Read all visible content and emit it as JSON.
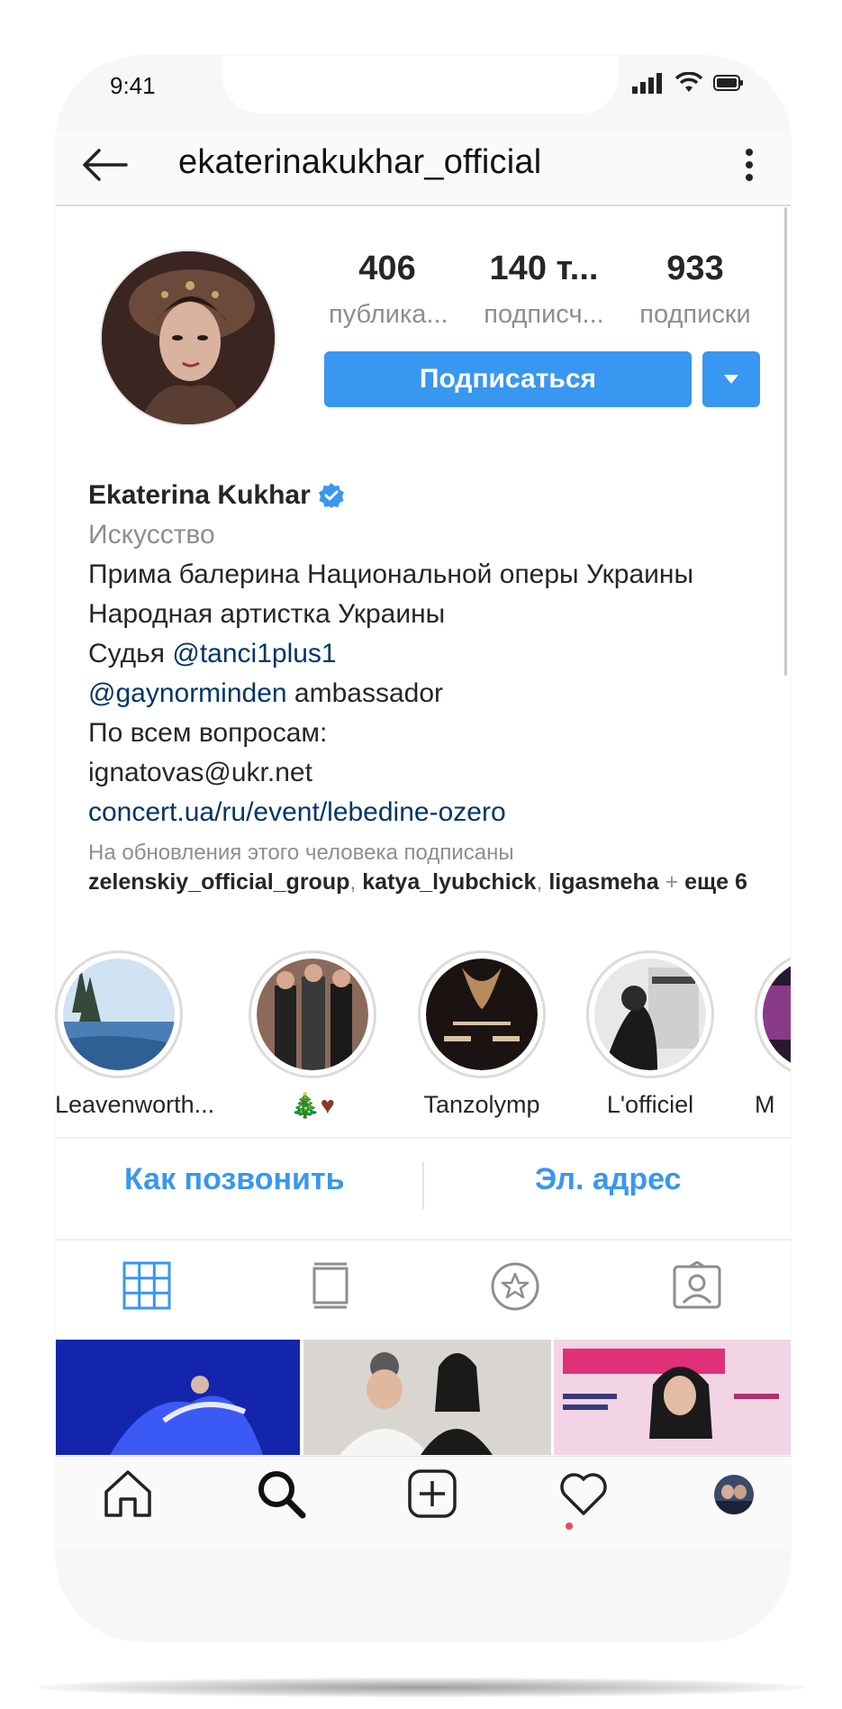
{
  "status_bar": {
    "time": "9:41"
  },
  "header": {
    "username": "ekaterinakukhar_official"
  },
  "stats": [
    {
      "value": "406",
      "label": "публика..."
    },
    {
      "value": "140 т...",
      "label": "подписч..."
    },
    {
      "value": "933",
      "label": "подписки"
    }
  ],
  "actions": {
    "follow_label": "Подписаться"
  },
  "bio": {
    "name": "Ekaterina Kukhar",
    "category": "Искусство",
    "line1": "Прима балерина Национальной оперы Украины",
    "line2": "Народная артистка Украины",
    "line3_prefix": "Судья ",
    "line3_link": "@tanci1plus1",
    "line4_link": "@gaynorminden",
    "line4_suffix": " ambassador",
    "line5": "По всем вопросам:",
    "line6": "ignatovas@ukr.net",
    "website": "concert.ua/ru/event/lebedine-ozero"
  },
  "followed_by": {
    "note": "На обновления этого человека подписаны",
    "user1": "zelenskiy_official_group",
    "user2": "katya_lyubchick",
    "user3": "ligasmeha",
    "plus": " + ",
    "more": "еще 6",
    "comma": ", "
  },
  "highlights": [
    {
      "label": "Leavenworth..."
    },
    {
      "label": "🎄♥"
    },
    {
      "label": "Tanzolymp"
    },
    {
      "label": "L'officiel"
    },
    {
      "label": "M"
    }
  ],
  "contacts": {
    "call": "Как позвонить",
    "email": "Эл. адрес"
  },
  "colors": {
    "accent": "#3897f0",
    "link": "#003569",
    "muted": "#8e8e8e",
    "notification": "#ed4956"
  },
  "icons": {
    "tabs": [
      "grid-icon",
      "feed-icon",
      "saved-icon",
      "tagged-icon"
    ],
    "bottom_nav": [
      "home-icon",
      "search-icon",
      "add-icon",
      "heart-icon",
      "profile-avatar"
    ]
  }
}
